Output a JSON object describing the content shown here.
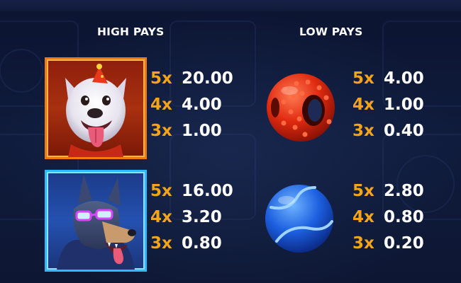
{
  "sections": {
    "high_pays_title": "HIGH PAYS",
    "low_pays_title": "LOW PAYS"
  },
  "colors": {
    "count_color": "#f5a418",
    "value_color": "#ffffff",
    "background": "#0c1530"
  },
  "symbols": [
    {
      "id": "bulldog",
      "icon": "white-bulldog-party-hat-icon",
      "group": "high",
      "pays": [
        {
          "count": "5x",
          "value": "20.00"
        },
        {
          "count": "4x",
          "value": "4.00"
        },
        {
          "count": "3x",
          "value": "1.00"
        }
      ]
    },
    {
      "id": "dobermann",
      "icon": "dobermann-with-glasses-icon",
      "group": "high",
      "pays": [
        {
          "count": "5x",
          "value": "16.00"
        },
        {
          "count": "4x",
          "value": "3.20"
        },
        {
          "count": "3x",
          "value": "0.80"
        }
      ]
    },
    {
      "id": "red_ball",
      "icon": "red-rubber-ball-icon",
      "group": "low",
      "pays": [
        {
          "count": "5x",
          "value": "4.00"
        },
        {
          "count": "4x",
          "value": "1.00"
        },
        {
          "count": "3x",
          "value": "0.40"
        }
      ]
    },
    {
      "id": "blue_ball",
      "icon": "blue-tennis-ball-icon",
      "group": "low",
      "pays": [
        {
          "count": "5x",
          "value": "2.80"
        },
        {
          "count": "4x",
          "value": "0.80"
        },
        {
          "count": "3x",
          "value": "0.20"
        }
      ]
    }
  ]
}
